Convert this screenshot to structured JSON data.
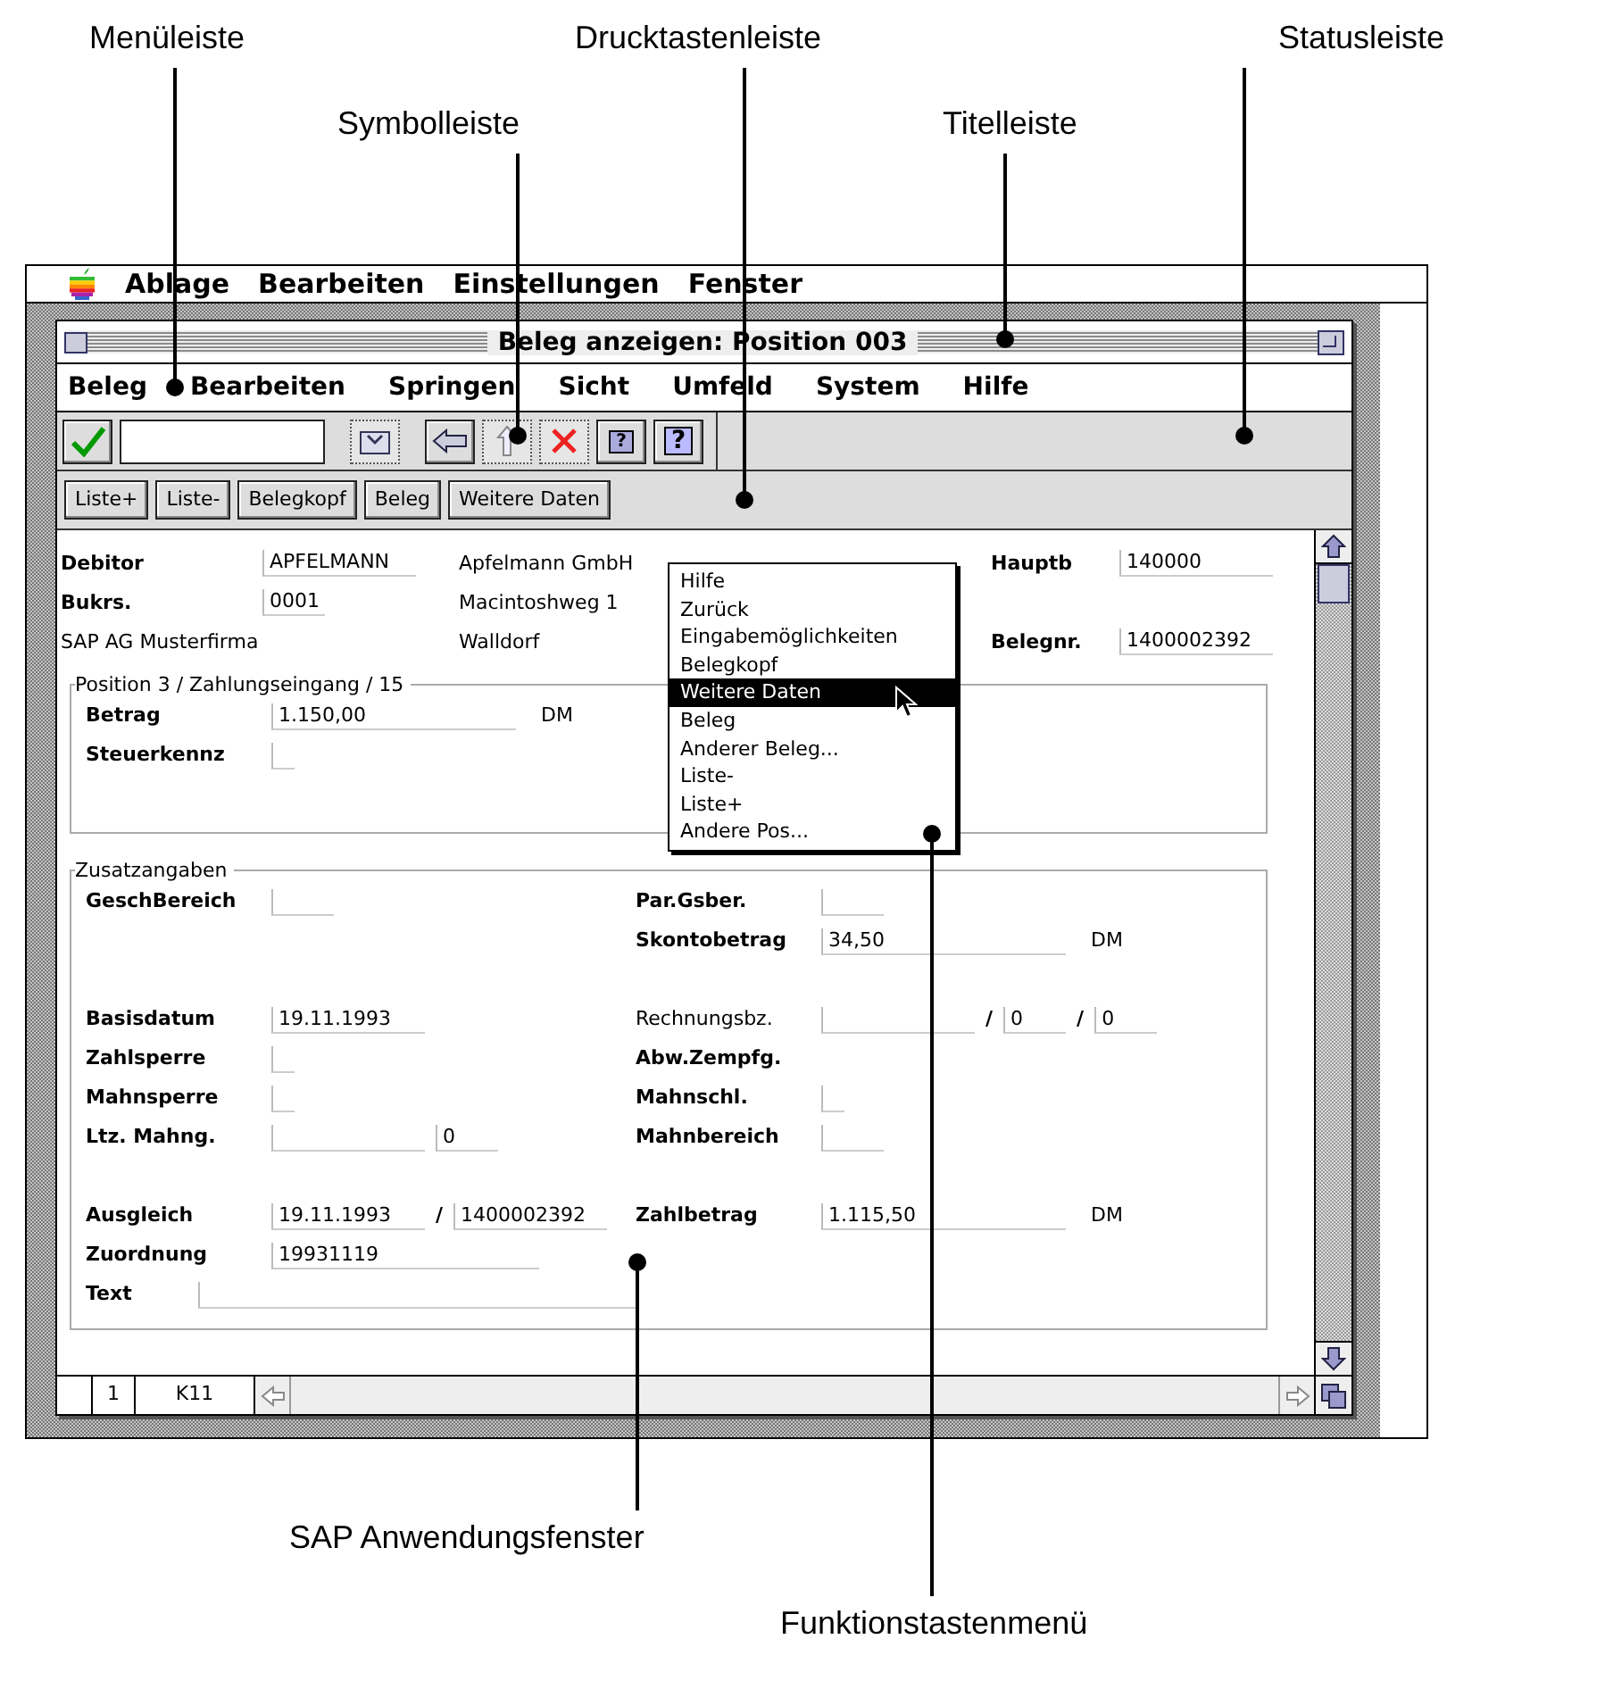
{
  "callouts": [
    {
      "label": "Menüleiste"
    },
    {
      "label": "Drucktastenleiste"
    },
    {
      "label": "Statusleiste"
    },
    {
      "label": "Symbolleiste"
    },
    {
      "label": "Titelleiste"
    },
    {
      "label": "SAP Anwendungsfenster"
    },
    {
      "label": "Funktionstastenmenü"
    }
  ],
  "system_menu": [
    "Ablage",
    "Bearbeiten",
    "Einstellungen",
    "Fenster"
  ],
  "window": {
    "title": "Beleg anzeigen: Position 003"
  },
  "menu": [
    "Beleg",
    "Bearbeiten",
    "Springen",
    "Sicht",
    "Umfeld",
    "System",
    "Hilfe"
  ],
  "toolbar": [
    {
      "kind": "enter",
      "disabled": false
    },
    {
      "kind": "command",
      "disabled": false
    },
    {
      "kind": "save",
      "disabled": true
    },
    {
      "kind": "back",
      "disabled": false
    },
    {
      "kind": "up",
      "disabled": true
    },
    {
      "kind": "cancel",
      "disabled": true
    },
    {
      "kind": "screen",
      "disabled": false,
      "symbol": "?"
    },
    {
      "kind": "help",
      "disabled": false,
      "symbol": "?"
    }
  ],
  "pushbuttons": [
    "Liste+",
    "Liste-",
    "Belegkopf",
    "Beleg",
    "Weitere Daten"
  ],
  "header": [
    [
      {
        "kind": "label",
        "text": "Debitor"
      },
      {
        "kind": "date",
        "value": "APFELMANN"
      },
      {
        "kind": "text",
        "text": "Apfelmann GmbH"
      },
      {
        "kind": "label",
        "text": "Hauptb"
      },
      {
        "kind": "date",
        "value": "140000"
      }
    ],
    [
      {
        "kind": "label",
        "text": "Bukrs."
      },
      {
        "kind": "code",
        "value": "0001"
      },
      {
        "kind": "text",
        "text": "Macintoshweg 1"
      }
    ],
    [
      {
        "kind": "caption",
        "text": "SAP AG Musterfirma"
      },
      {
        "kind": "text",
        "text": "Walldorf"
      },
      {
        "kind": "label",
        "text": "Belegnr."
      },
      {
        "kind": "date",
        "value": "1400002392"
      }
    ]
  ],
  "position_box": {
    "title": "Position 3 / Zahlungseingang / 15",
    "rows": [
      {
        "left": [
          {
            "kind": "label",
            "text": "Betrag"
          },
          {
            "kind": "amount",
            "value": "1.150,00"
          },
          {
            "kind": "unit",
            "text": "DM"
          }
        ]
      },
      {
        "left": [
          {
            "kind": "label",
            "text": "Steuerkennz"
          },
          {
            "kind": "flag"
          }
        ]
      }
    ]
  },
  "additional_box": {
    "title": "Zusatzangaben",
    "groups": [
      [
        {
          "left": [
            {
              "kind": "label",
              "text": "GeschBereich"
            },
            {
              "kind": "code"
            }
          ],
          "right": [
            {
              "kind": "label",
              "text": "Par.Gsber."
            },
            {
              "kind": "code"
            }
          ]
        },
        {
          "right": [
            {
              "kind": "label",
              "text": "Skontobetrag"
            },
            {
              "kind": "amount",
              "value": "34,50"
            },
            {
              "kind": "unit",
              "text": "DM"
            }
          ]
        }
      ],
      [
        {
          "left": [
            {
              "kind": "label",
              "text": "Basisdatum"
            },
            {
              "kind": "date",
              "value": "19.11.1993"
            }
          ],
          "right": [
            {
              "kind": "plain",
              "text": "Rechnungsbz."
            },
            {
              "kind": "date"
            },
            {
              "kind": "slash",
              "text": "/"
            },
            {
              "kind": "code",
              "value": "0"
            },
            {
              "kind": "slash",
              "text": "/"
            },
            {
              "kind": "code",
              "value": "0"
            }
          ]
        },
        {
          "left": [
            {
              "kind": "label",
              "text": "Zahlsperre"
            },
            {
              "kind": "flag"
            }
          ],
          "right": [
            {
              "kind": "label",
              "text": "Abw.Zempfg."
            }
          ]
        },
        {
          "left": [
            {
              "kind": "label",
              "text": "Mahnsperre"
            },
            {
              "kind": "flag"
            }
          ],
          "right": [
            {
              "kind": "label",
              "text": "Mahnschl."
            },
            {
              "kind": "flag"
            }
          ]
        },
        {
          "left": [
            {
              "kind": "label",
              "text": "Ltz. Mahng."
            },
            {
              "kind": "date"
            },
            {
              "kind": "code",
              "value": "0"
            }
          ],
          "right": [
            {
              "kind": "label",
              "text": "Mahnbereich"
            },
            {
              "kind": "code"
            }
          ]
        }
      ],
      [
        {
          "left": [
            {
              "kind": "label",
              "text": "Ausgleich"
            },
            {
              "kind": "date",
              "value": "19.11.1993"
            },
            {
              "kind": "slash",
              "text": "/"
            },
            {
              "kind": "date",
              "value": "1400002392"
            }
          ],
          "right": [
            {
              "kind": "label",
              "text": "Zahlbetrag"
            },
            {
              "kind": "amount",
              "value": "1.115,50"
            },
            {
              "kind": "unit",
              "text": "DM"
            }
          ]
        },
        {
          "left": [
            {
              "kind": "label",
              "text": "Zuordnung"
            },
            {
              "kind": "assign",
              "value": "19931119"
            }
          ]
        },
        {
          "left": [
            {
              "kind": "label",
              "text": "Text"
            },
            {
              "kind": "long"
            }
          ]
        }
      ]
    ]
  },
  "context_menu": [
    {
      "label": "Hilfe",
      "selected": false
    },
    {
      "label": "Zurück",
      "selected": false
    },
    {
      "label": "Eingabemöglichkeiten",
      "selected": false
    },
    {
      "label": "Belegkopf",
      "selected": false
    },
    {
      "label": "Weitere Daten",
      "selected": true
    },
    {
      "label": "Beleg",
      "selected": false
    },
    {
      "label": "Anderer Beleg...",
      "selected": false
    },
    {
      "label": "Liste-",
      "selected": false
    },
    {
      "label": "Liste+",
      "selected": false
    },
    {
      "label": "Andere Pos...",
      "selected": false
    }
  ],
  "status_bar": {
    "fields": [
      "1",
      "K11"
    ]
  }
}
